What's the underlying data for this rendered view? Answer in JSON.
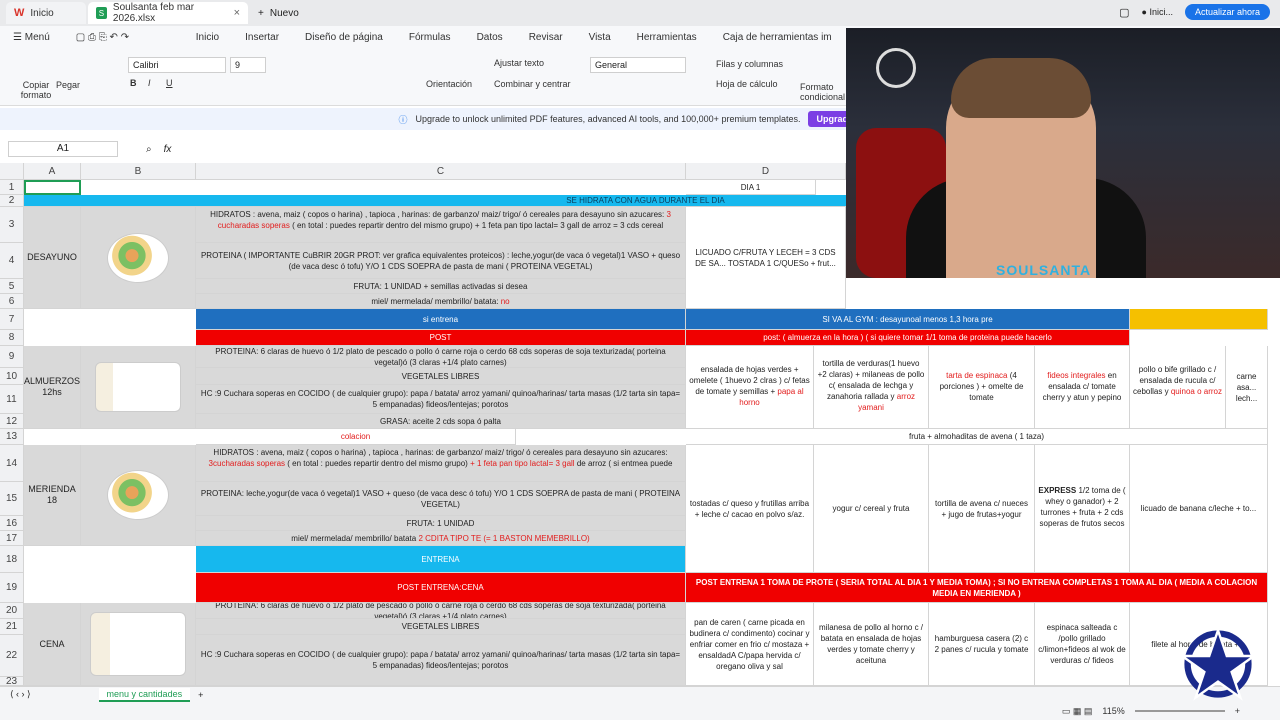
{
  "tabs": {
    "home_label": "Inicio",
    "file_label": "Soulsanta feb mar 2026.xlsx",
    "new_label": "Nuevo"
  },
  "account": {
    "name": "Inici...",
    "update_label": "Actualizar ahora"
  },
  "menu": {
    "menu_label": "Menú",
    "items": [
      "Inicio",
      "Insertar",
      "Diseño de página",
      "Fórmulas",
      "Datos",
      "Revisar",
      "Vista",
      "Herramientas",
      "Caja de herramientas im"
    ]
  },
  "ribbon": {
    "copy_format": "Copiar formato",
    "paste": "Pegar",
    "font": "Calibri",
    "font_size": "9",
    "wrap": "Ajustar texto",
    "merge": "Combinar y centrar",
    "orientation": "Orientación",
    "number_format": "General",
    "rows_cols": "Filas y columnas",
    "sheet": "Hoja de cálculo",
    "cond_format": "Formato condicional"
  },
  "notice": {
    "text": "Upgrade to unlock unlimited PDF features, advanced AI tools, and 100,000+ premium templates.",
    "button": "Upgrade now"
  },
  "formula": {
    "cell_ref": "A1",
    "fx": "fx"
  },
  "columns": [
    "A",
    "B",
    "C",
    "D"
  ],
  "rows": [
    "1",
    "2",
    "3",
    "4",
    "5",
    "6",
    "7",
    "8",
    "9",
    "10",
    "11",
    "12",
    "13",
    "14",
    "15",
    "16",
    "17",
    "18",
    "19",
    "20",
    "21",
    "22",
    "23"
  ],
  "cells": {
    "d1": "DIA 1",
    "r2": "SE HIDRATA CON AGUA DURANTE EL DIA",
    "desayuno": "DESAYUNO",
    "c3a": "HIDRATOS : avena, maiz ( copos o harina) , tapioca , harinas: de garbanzo/ maiz/ trigo/ ó cereales para desayuno sin azucares:",
    "c3b": "3 cucharadas soperas",
    "c3c": "( en total : puedes repartir dentro del mismo grupo)",
    "c3d": "+ 1 feta pan tipo lactal= 3 gall de arroz = 3 cds cereal",
    "c4": "PROTEINA ( IMPORTANTE CuBRIR 20GR PROT: ver grafica equivalentes proteicos) : leche,yogur(de vaca ó vegetal)1 VASO + queso (de vaca desc ó tofu) Y/O 1 CDS SOEPRA de pasta de mani ( PROTEINA VEGETAL)",
    "d4": "LICUADO C/FRUTA Y LECEH = 3 CDS DE SA... TOSTADA 1 C/QUESo + frut...",
    "c5": "FRUTA: 1 UNIDAD + semillas activadas si desea",
    "c6a": "miel/ mermelada/ membrillo/ batata:",
    "c6b": "no",
    "c7": "si entrena",
    "d7": "SI VA AL GYM : desayunoal menos 1,3 hora pre",
    "c8": "POST",
    "d8": "post: ( almuerza en la hora ) ( si quiere tomar 1/1 toma de proteina puede hacerlo",
    "almuerzos": "ALMUERZOS 12hs",
    "c9": "PROTEINA: 6 claras de huevo ó 1/2 plato de pescado o pollo ó carne roja o cerdo 68 cds soperas de soja texturizada( porteina vegetal)ó (3 claras +1/4 plato carnes)",
    "c10": "VEGETALES LIBRES",
    "c11": "HC :9 Cuchara soperas en COCIDO ( de cualquier grupo): papa / batata/ arroz yamani/ quinoa/harinas/ tarta masas (1/2 tarta sin tapa= 5 empanadas) fideos/lentejas; porotos",
    "c12": "GRASA: aceite 2 cds sopa ó palta",
    "d10a": "ensalada de hojas verdes + omelete ( 1huevo 2 clras ) c/ fetas de tomate y semillas +",
    "d10b": "papa al horno",
    "e10a": "tortilla de verduras(1 huevo +2 claras) + milaneas de pollo c( ensalada de lechga y zanahoria rallada y",
    "e10b": "arroz yamani",
    "f10a": "tarta de espinaca",
    "f10b": "(4 porciones ) + omelte de tomate",
    "g10a": "fideos integrales",
    "g10b": "en ensalada c/ tomate cherry y atun y pepino",
    "h10a": "pollo o bife grillado c / ensalada de rucula c/ cebollas y",
    "h10b": "quinoa o arroz",
    "i10": "carne asa... lech...",
    "c13": "colacion",
    "d13": "fruta + almohaditas de avena ( 1 taza)",
    "merienda": "MERIENDA 18",
    "c14a": "HIDRATOS : avena, maiz ( copos o harina) , tapioca , harinas: de garbanzo/ maiz/ trigo/ ó cereales para desayuno sin azucares:",
    "c14b": "3cucharadas soperas",
    "c14c": "( en total : puedes repartir dentro del mismo grupo)",
    "c14d": "+ 1 feta pan tipo lactal= 3 gall",
    "c14e": "de arroz ( si entmea puede",
    "c15": "PROTEINA: leche,yogur(de vaca ó vegetal)1 VASO + queso (de vaca desc ó tofu) Y/O 1 CDS SOEPRA de pasta de mani ( PROTEINA VEGETAL)",
    "d15": "tostadas c/ queso y frutillas arriba + leche c/ cacao en polvo s/az.",
    "e15": "yogur c/ cereal y fruta",
    "f15": "tortilla de avena c/ nueces + jugo de frutas+yogur",
    "g15a": "EXPRESS",
    "g15b": "1/2 toma de ( whey o ganador) + 2 turrones + fruta + 2 cds soperas de frutos secos",
    "h15": "licuado de banana c/leche + to...",
    "c16": "FRUTA: 1 UNIDAD",
    "c17a": "miel/ mermelada/ membrillo/ batata",
    "c17b": "2 CDITA TIPO TE (= 1 BASTON MEMEBRILLO)",
    "c18": "ENTRENA",
    "c19": "POST ENTRENA:CENA",
    "d19": "POST ENTRENA 1 TOMA DE PROTE ( SERIA TOTAL AL DIA 1 Y MEDIA TOMA) ; SI NO ENTRENA COMPLETAS 1 TOMA AL DIA ( MEDIA A COLACION MEDIA EN MERIENDA )",
    "cena": "CENA",
    "c20": "PROTEINA: 6 claras de huevo ó 1/2 plato de pescado o pollo ó carne roja o cerdo 68 cds soperas de soja texturizada( porteina vegetal)ó (3 claras +1/4 plato carnes)",
    "c21": "VEGETALES LIBRES",
    "c22": "HC :9 Cuchara soperas en COCIDO ( de cualquier grupo): papa / batata/ arroz yamani/ quinoa/harinas/ tarta masas (1/2 tarta sin tapa= 5 empanadas) fideos/lentejas; porotos",
    "d21": "pan de caren ( carne picada en budinera c/ condimento) cocinar y enfriar comer en frio c/ mostaza + ensaldadA C/papa hervida c/ oregano oliva y sal",
    "e21": "milanesa de pollo al horno c / batata en ensalada de hojas verdes y tomate cherry y aceituna",
    "f21": "hamburguesa casera (2) c 2 panes c/ rucula y tomate",
    "g21": "espinaca salteada c /pollo grillado c/limon+fideos al wok de verduras c/ fideos",
    "h21": "filete al hor... de batata +..."
  },
  "sheet_tab": "menu y cantidades",
  "zoom": "115%",
  "stream_tag": "SOULSANTA"
}
